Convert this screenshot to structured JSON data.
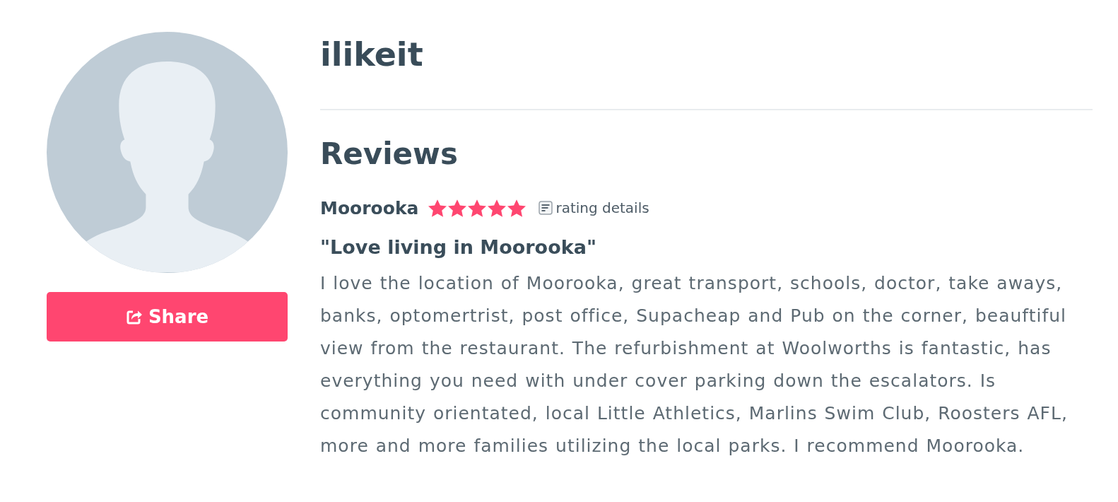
{
  "profile": {
    "username": "ilikeit",
    "share_button": {
      "label": "Share"
    }
  },
  "reviews": {
    "heading": "Reviews",
    "items": [
      {
        "suburb": "Moorooka",
        "stars": 5,
        "rating_details": "rating details",
        "title": "\"Love living in Moorooka\"",
        "body": "I love the location of Moorooka, great transport, schools, doctor, take aways, banks, optomertrist, post office, Supacheap and Pub on the corner, beauftiful view from the restaurant. The refurbishment at Woolworths is fantastic, has everything you need with under cover parking down the escalators. Is community orientated, local Little Athletics, Marlins Swim Club, Roosters AFL, more and more families utilizing the local parks. I recommend Moorooka."
      }
    ]
  }
}
